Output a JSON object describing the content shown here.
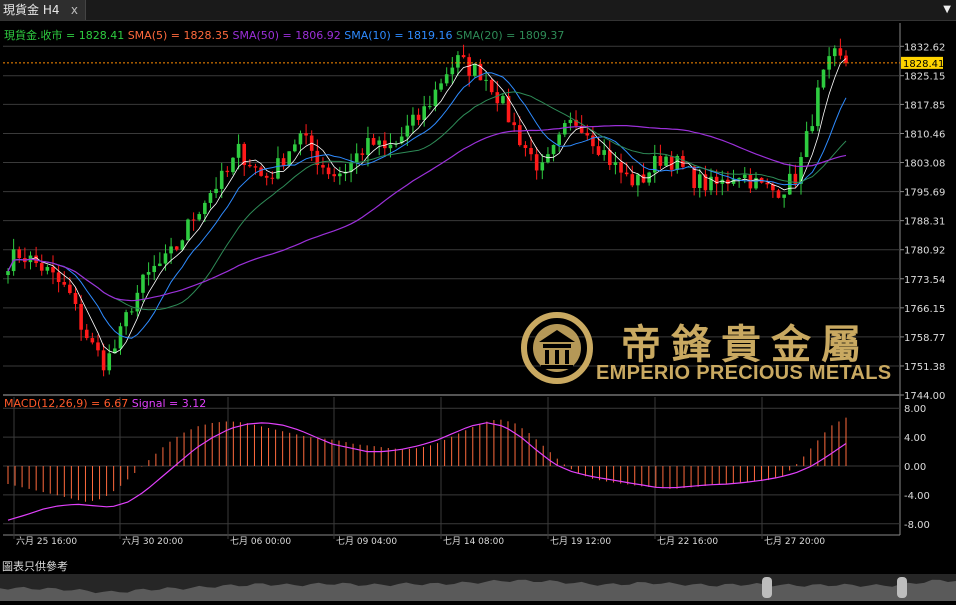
{
  "window": {
    "tab_title": "現貨金 H4",
    "close_glyph": "x",
    "menu_glyph": "▼"
  },
  "legend_main": [
    {
      "text": "現貨金.收市 = 1828.41",
      "color": "#2ecc40"
    },
    {
      "text": "SMA(5) = 1828.35",
      "color": "#ff6a3d"
    },
    {
      "text": "SMA(50) = 1806.92",
      "color": "#9b30d9"
    },
    {
      "text": "SMA(10) = 1819.16",
      "color": "#2e8bff"
    },
    {
      "text": "SMA(20) = 1809.37",
      "color": "#2e8b57"
    }
  ],
  "legend_macd": [
    {
      "text": "MACD(12,26,9) = 6.67",
      "color": "#ff5a2a"
    },
    {
      "text": "Signal = 3.12",
      "color": "#e040fb"
    }
  ],
  "price_axis": {
    "ticks": [
      "1832.62",
      "1825.15",
      "1817.85",
      "1810.46",
      "1803.08",
      "1795.69",
      "1788.31",
      "1780.92",
      "1773.54",
      "1766.15",
      "1758.77",
      "1751.38",
      "1744.00"
    ],
    "current_label": "1828.41"
  },
  "macd_axis": {
    "ticks": [
      "8.00",
      "4.00",
      "0.00",
      "-4.00",
      "-8.00"
    ]
  },
  "time_axis": {
    "ticks": [
      "六月 25 16:00",
      "六月 30 20:00",
      "七月 06 00:00",
      "七月 09 04:00",
      "七月 14 08:00",
      "七月 19 12:00",
      "七月 22 16:00",
      "七月 27 20:00"
    ]
  },
  "watermark": {
    "cn": "帝鋒貴金屬",
    "en": "EMPERIO PRECIOUS METALS"
  },
  "footer": {
    "text": "圖表只供參考"
  },
  "colors": {
    "up": "#2ecc40",
    "down": "#ff1a1a",
    "grid": "#3a3a3a",
    "price_line": "#ff8c00",
    "hist": "#ff6a3d"
  },
  "chart_data": [
    {
      "type": "candlestick",
      "title": "現貨金 H4",
      "ylim": [
        1744.0,
        1836.0
      ],
      "x_ticks": [
        "六月 25 16:00",
        "六月 30 20:00",
        "七月 06 00:00",
        "七月 09 04:00",
        "七月 14 08:00",
        "七月 19 12:00",
        "七月 22 16:00",
        "七月 27 20:00"
      ],
      "close_path": [
        1778,
        1780,
        1778,
        1776,
        1773,
        1770,
        1762,
        1756,
        1752,
        1757,
        1766,
        1772,
        1776,
        1778,
        1782,
        1788,
        1793,
        1797,
        1800,
        1806,
        1803,
        1799,
        1801,
        1806,
        1810,
        1806,
        1802,
        1800,
        1802,
        1806,
        1808,
        1806,
        1808,
        1812,
        1815,
        1820,
        1826,
        1829,
        1827,
        1826,
        1822,
        1816,
        1810,
        1805,
        1801,
        1806,
        1812,
        1814,
        1810,
        1806,
        1802,
        1799,
        1798,
        1802,
        1805,
        1803,
        1800,
        1798,
        1797,
        1798,
        1801,
        1799,
        1797,
        1796,
        1797,
        1800,
        1812,
        1824,
        1830,
        1828
      ],
      "last_close": 1828.41,
      "series": [
        {
          "name": "SMA(5)",
          "last": 1828.35
        },
        {
          "name": "SMA(10)",
          "last": 1819.16
        },
        {
          "name": "SMA(20)",
          "last": 1809.37
        },
        {
          "name": "SMA(50)",
          "last": 1806.92
        }
      ]
    },
    {
      "type": "bar",
      "title": "MACD(12,26,9)",
      "ylim": [
        -9,
        9
      ],
      "macd_last": 6.67,
      "signal_last": 3.12,
      "macd_path": [
        -2.5,
        -3,
        -3.5,
        -4,
        -4.5,
        -5,
        -4.5,
        -3,
        -1,
        1,
        3,
        4.5,
        5.5,
        6,
        6.2,
        6,
        5.5,
        5,
        4.5,
        4,
        3.8,
        3.5,
        3,
        2.8,
        2.5,
        2.3,
        2.5,
        3,
        4,
        5,
        6,
        6.5,
        6,
        4.5,
        2.5,
        0.5,
        -1,
        -1.8,
        -2.2,
        -2.5,
        -2.8,
        -3,
        -3.2,
        -3,
        -2.8,
        -2.5,
        -2.5,
        -2.2,
        -2,
        -1.5,
        0.5,
        3,
        5.5,
        6.7
      ],
      "signal_path": [
        -7.5,
        -6.8,
        -6,
        -5.5,
        -5.3,
        -5.5,
        -5.7,
        -5,
        -3.5,
        -1.5,
        0.5,
        2.5,
        4,
        5.2,
        5.8,
        6,
        5.7,
        5,
        4,
        3,
        2.5,
        2,
        2,
        2.3,
        2.8,
        3.5,
        4.5,
        5.5,
        6,
        5.5,
        4,
        2,
        0.2,
        -0.8,
        -1.4,
        -1.8,
        -2.2,
        -2.6,
        -3,
        -3,
        -2.8,
        -2.6,
        -2.5,
        -2.3,
        -2,
        -1.6,
        -1,
        0,
        1.5,
        3.12
      ]
    }
  ]
}
